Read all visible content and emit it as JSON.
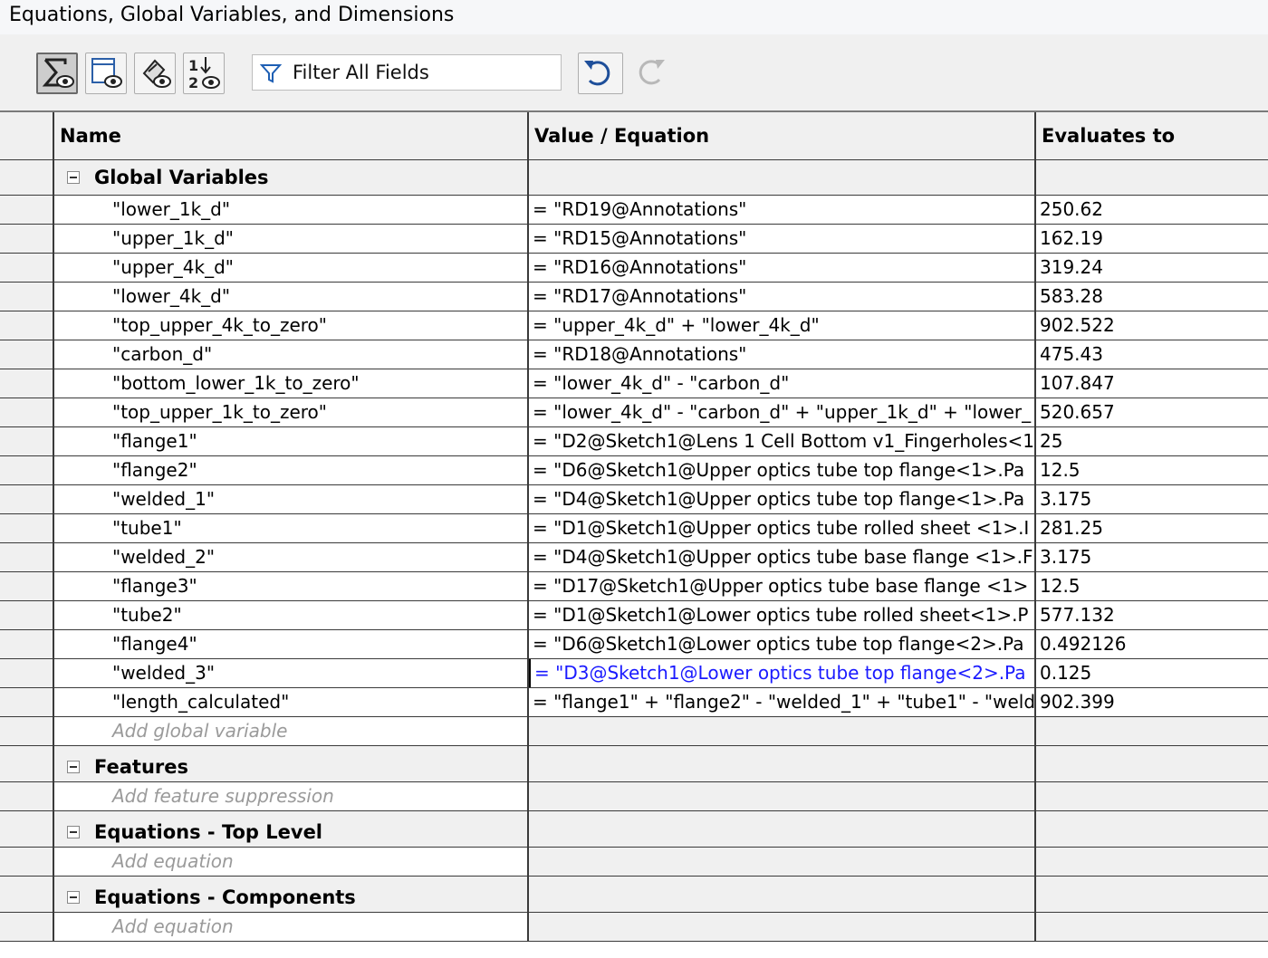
{
  "window": {
    "title": "Equations, Global Variables, and Dimensions"
  },
  "toolbar": {
    "buttons": [
      {
        "icon": "equation-view-icon",
        "active": true
      },
      {
        "icon": "sketch-equation-view-icon",
        "active": false
      },
      {
        "icon": "dimension-view-icon",
        "active": false
      },
      {
        "icon": "ordered-view-icon",
        "active": false
      }
    ],
    "filter_placeholder": "Filter All Fields",
    "undo_icon": "undo-icon",
    "redo_icon": "redo-icon"
  },
  "table": {
    "headers": {
      "name": "Name",
      "value": "Value / Equation",
      "evaluates": "Evaluates to"
    },
    "sections": {
      "global": {
        "title": "Global Variables",
        "rows": [
          {
            "name": "\"lower_1k_d\"",
            "value": "= \"RD19@Annotations\"",
            "eval": "250.62"
          },
          {
            "name": "\"upper_1k_d\"",
            "value": "= \"RD15@Annotations\"",
            "eval": "162.19"
          },
          {
            "name": "\"upper_4k_d\"",
            "value": "= \"RD16@Annotations\"",
            "eval": "319.24"
          },
          {
            "name": "\"lower_4k_d\"",
            "value": "= \"RD17@Annotations\"",
            "eval": "583.28"
          },
          {
            "name": "\"top_upper_4k_to_zero\"",
            "value": "= \"upper_4k_d\" + \"lower_4k_d\"",
            "eval": "902.522"
          },
          {
            "name": "\"carbon_d\"",
            "value": "= \"RD18@Annotations\"",
            "eval": "475.43"
          },
          {
            "name": "\"bottom_lower_1k_to_zero\"",
            "value": "= \"lower_4k_d\" - \"carbon_d\"",
            "eval": "107.847"
          },
          {
            "name": "\"top_upper_1k_to_zero\"",
            "value": "= \"lower_4k_d\" - \"carbon_d\" + \"upper_1k_d\" + \"lower_",
            "eval": "520.657"
          },
          {
            "name": "\"flange1\"",
            "value": "= \"D2@Sketch1@Lens 1 Cell Bottom v1_Fingerholes<1",
            "eval": "25"
          },
          {
            "name": "\"flange2\"",
            "value": "= \"D6@Sketch1@Upper optics tube top flange<1>.Pa",
            "eval": "12.5"
          },
          {
            "name": "\"welded_1\"",
            "value": "= \"D4@Sketch1@Upper optics tube top flange<1>.Pa",
            "eval": "3.175"
          },
          {
            "name": "\"tube1\"",
            "value": "= \"D1@Sketch1@Upper optics tube rolled sheet <1>.I",
            "eval": "281.25"
          },
          {
            "name": "\"welded_2\"",
            "value": "= \"D4@Sketch1@Upper optics tube base flange <1>.F",
            "eval": "3.175"
          },
          {
            "name": "\"flange3\"",
            "value": "= \"D17@Sketch1@Upper optics tube base flange <1>",
            "eval": "12.5"
          },
          {
            "name": "\"tube2\"",
            "value": "= \"D1@Sketch1@Lower optics tube rolled sheet<1>.P",
            "eval": "577.132"
          },
          {
            "name": "\"flange4\"",
            "value": "= \"D6@Sketch1@Lower optics tube top flange<2>.Pa",
            "eval": "0.492126"
          },
          {
            "name": "\"welded_3\"",
            "value": "= \"D3@Sketch1@Lower optics tube top flange<2>.Pa",
            "eval": "0.125",
            "editing": true
          },
          {
            "name": "\"length_calculated\"",
            "value": "= \"flange1\" + \"flange2\" - \"welded_1\" + \"tube1\" - \"weld",
            "eval": "902.399"
          }
        ],
        "add_label": "Add global variable"
      },
      "features": {
        "title": "Features",
        "add_label": "Add feature suppression"
      },
      "top_level": {
        "title": "Equations - Top Level",
        "add_label": "Add equation"
      },
      "components": {
        "title": "Equations - Components",
        "add_label": "Add equation"
      }
    }
  },
  "colors": {
    "editing_text": "#1a1aff",
    "grid_line": "#3a3a3a",
    "header_bg": "#f0f0f0"
  }
}
